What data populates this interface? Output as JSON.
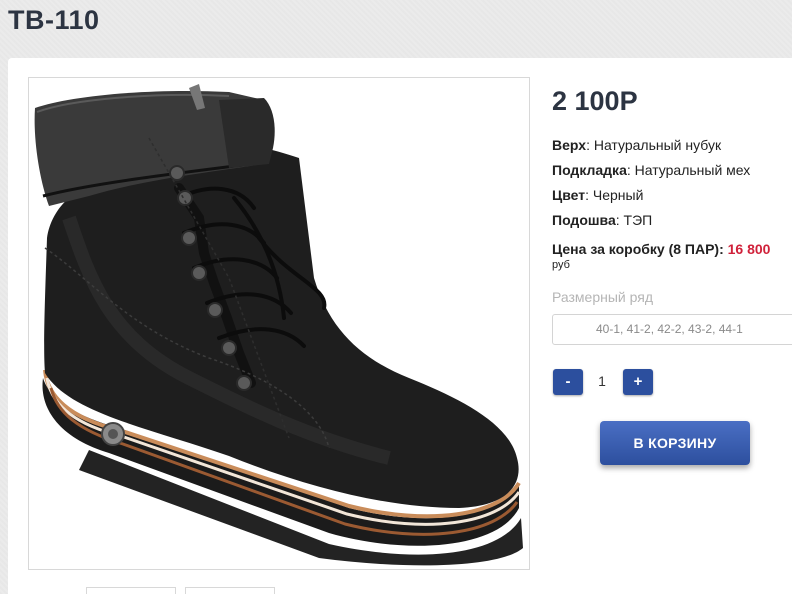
{
  "product": {
    "title": "ТВ-110",
    "image_alt": "black-nubuck-lace-up-boot",
    "price": "2 100Р",
    "specs": [
      {
        "label": "Верх",
        "value": ": Натуральный нубук"
      },
      {
        "label": "Подкладка",
        "value": ": Натуральный мех"
      },
      {
        "label": "Цвет",
        "value": ": Черный"
      },
      {
        "label": "Подошва",
        "value": ": ТЭП"
      }
    ],
    "box_price": {
      "label": "Цена за коробку (8 ПАР):",
      "value": "16 800",
      "currency": "руб"
    },
    "size_row": {
      "label": "Размерный ряд",
      "value": "40-1, 41-2, 42-2, 43-2, 44-1"
    },
    "quantity": {
      "minus": "-",
      "value": "1",
      "plus": "+"
    },
    "add_to_cart": "В КОРЗИНУ"
  },
  "colors": {
    "title": "#2c3442",
    "accent": "#2c4f9e",
    "price_highlight": "#d0213a"
  }
}
